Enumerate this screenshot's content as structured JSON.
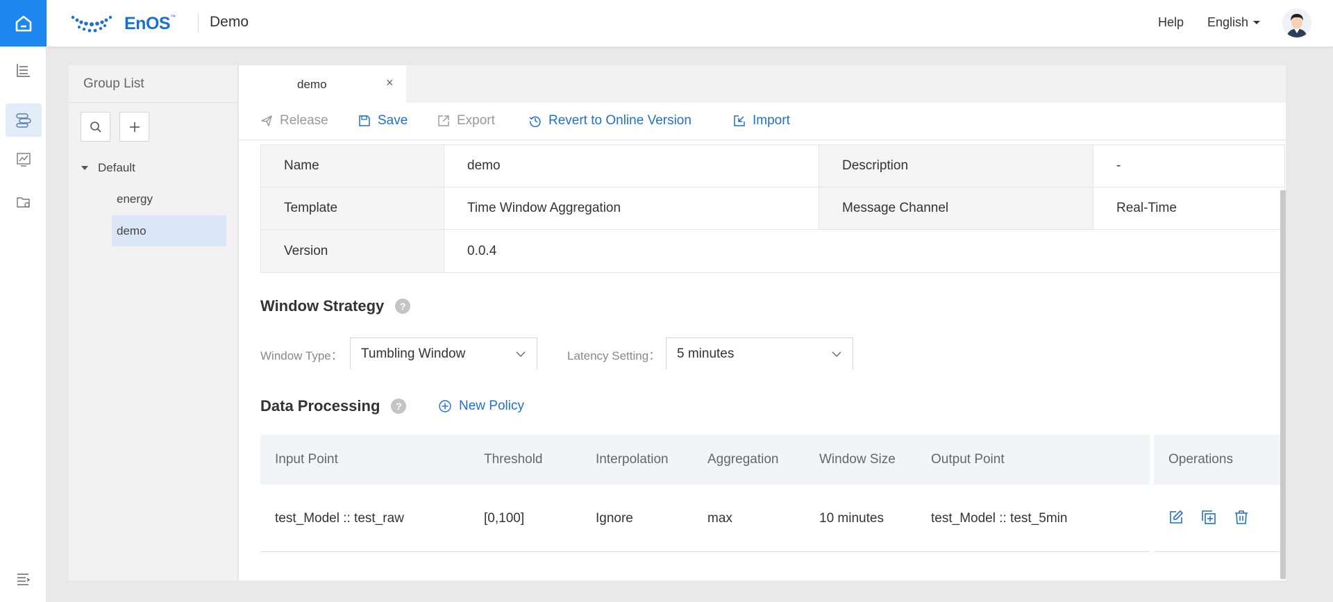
{
  "topbar": {
    "logo_text": "EnOS",
    "logo_tm": "™",
    "app_title": "Demo",
    "help": "Help",
    "language": "English"
  },
  "rail": {
    "icons": [
      "home-icon",
      "table-chart-icon",
      "stream-process-icon",
      "monitor-chart-icon",
      "folder-settings-icon",
      "collapse-menu-icon"
    ],
    "accent": "#1e86ef"
  },
  "group_list": {
    "title": "Group List",
    "root": "Default",
    "children": [
      "energy",
      "demo"
    ],
    "selected": "demo"
  },
  "tabs": [
    {
      "label": "demo",
      "close": "×"
    }
  ],
  "toolbar": {
    "release": "Release",
    "save": "Save",
    "export": "Export",
    "revert": "Revert to Online Version",
    "import": "Import"
  },
  "info": {
    "name_label": "Name",
    "name_value": "demo",
    "description_label": "Description",
    "description_value": "-",
    "template_label": "Template",
    "template_value": "Time Window Aggregation",
    "channel_label": "Message Channel",
    "channel_value": "Real-Time",
    "version_label": "Version",
    "version_value": "0.0.4"
  },
  "window_strategy": {
    "title": "Window Strategy",
    "help": "?",
    "window_type_label": "Window Type：",
    "window_type_value": "Tumbling Window",
    "latency_label": "Latency Setting：",
    "latency_value": "5 minutes"
  },
  "data_processing": {
    "title": "Data Processing",
    "help": "?",
    "new_policy": "New Policy",
    "columns": [
      "Input Point",
      "Threshold",
      "Interpolation",
      "Aggregation",
      "Window Size",
      "Output Point",
      "Operations"
    ],
    "rows": [
      {
        "input_point": "test_Model :: test_raw",
        "threshold": "[0,100]",
        "interpolation": "Ignore",
        "aggregation": "max",
        "window_size": "10 minutes",
        "output_point": "test_Model :: test_5min"
      }
    ]
  },
  "colors": {
    "primary": "#1f6fd0",
    "disabled": "#999999",
    "selected_bg": "#dbe7f8"
  }
}
